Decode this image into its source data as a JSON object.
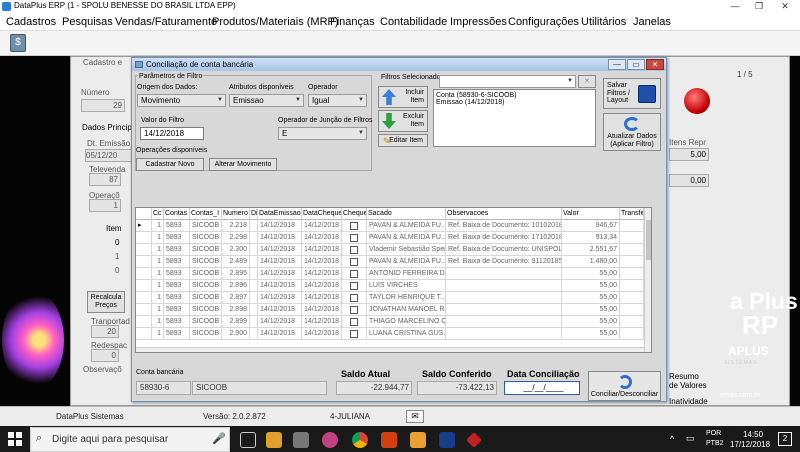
{
  "app": {
    "title": "DataPlus ERP (1 - SPOLU BENESSE DO BRASIL LTDA EPP)",
    "window_controls": {
      "minimize": "—",
      "maximize": "❐",
      "close": "✕"
    },
    "menu": [
      "Cadastros",
      "Pesquisas",
      "Vendas/Faturamento",
      "Produtos/Materiais (MRP)",
      "Finanças",
      "Contabilidade",
      "Impressões",
      "Configurações",
      "Utilitários",
      "Janelas"
    ]
  },
  "background_window": {
    "title": "Cadastro e",
    "numero_label": "Número",
    "numero_value": "29",
    "tab_label": "Dados Princip",
    "dt_emissao_label": "Dt. Emissão",
    "dt_emissao_value": "05/12/20",
    "televendas_label": "Televenda",
    "televendas_value": "87",
    "operacao_label": "Operaçõ",
    "operacao_value": "1",
    "item_label": "Item",
    "item_values": [
      "0",
      "1",
      "0"
    ],
    "recalcular_label": "Recalcula Preços",
    "transportadora_label": "Tranportad",
    "transportadora_value": "20",
    "redespacho_label": "Redespac",
    "redespacho_value": "0",
    "observacoes_label": "Observaçõ",
    "page_counter": "1 / 5",
    "itens_header": "Itens Repr",
    "val_500": "5,00",
    "val_000": "0,00",
    "resumo_label": "Resumo de Valores",
    "inatividade_label": "Inatividade",
    "site_text": "emas.com.br"
  },
  "branding": {
    "line1": "a Plus",
    "line2": "RP",
    "line3": "APLUS",
    "line4": "SISTEMAS"
  },
  "statusbar": {
    "company": "DataPlus Sistemas",
    "version": "Versão: 2.0.2.872",
    "user": "4-JULIANA"
  },
  "dialog": {
    "title": "Conciliação de conta bancária",
    "window_controls": {
      "minimize": "—",
      "maximize": "▭",
      "close": "✕"
    },
    "params_group": "Parâmetros de Filtro",
    "origem_label": "Origem dos Dados:",
    "origem_value": "Movimento",
    "atributos_label": "Atributos disponíveis",
    "atributos_value": "Emissao",
    "operador_label": "Operador",
    "operador_value": "Igual",
    "valor_filtro_label": "Valor do Filtro",
    "valor_filtro_value": "14/12/2018",
    "juncao_label": "Operador de Junção de Filtros",
    "juncao_value": "E",
    "operacoes_label": "Operações disponíveis",
    "cadastrar_novo": "Cadastrar Novo",
    "alterar_movimento": "Alterar Movimento",
    "filtros_selecionados_label": "Filtros Selecionados",
    "filtros_selecionados_items": [
      "Conta (58930-6-SICOOB)",
      "Emissao (14/12/2018)"
    ],
    "incluir_item": "Incluir Item",
    "excluir_item": "Excluir Item",
    "editar_item": "Editar Item",
    "salvar_filtros": "Salvar Filtros / Layout",
    "atualizar_dados": "Atualizar Dados (Aplicar Filtro)",
    "conta_bancaria_label": "Conta bancária",
    "conta_numero": "58930-6",
    "conta_nome": "SICOOB",
    "saldo_atual_label": "Saldo Atual",
    "saldo_atual_value": "-22.944,77",
    "saldo_conferido_label": "Saldo Conferido",
    "saldo_conferido_value": "-73.422,13",
    "data_conciliacao_label": "Data Conciliação",
    "data_conciliacao_value": "__/__/____",
    "conciliar_button": "Conciliar/Desconciliar"
  },
  "grid": {
    "columns": [
      "Cc",
      "Contas",
      "Contas_I",
      "Numero",
      "Di",
      "DataEmissao",
      "DataCheque",
      "Cheque",
      "Sacado",
      "Observacoes",
      "Valor",
      "Transfe"
    ],
    "rows": [
      [
        "1",
        "5893",
        "SICOOB",
        "2.218",
        "14/12/2018",
        "14/12/2018",
        "PAVAN & ALMEIDA FU...",
        "Ref. Baixa de Documento: 10102018...",
        "946,67"
      ],
      [
        "1",
        "5893",
        "SICOOB",
        "2.298",
        "14/12/2018",
        "14/12/2018",
        "PAVAN & ALMEIDA FU...",
        "Ref. Baixa de Documento: 17102018...",
        "913,34"
      ],
      [
        "1",
        "5893",
        "SICOOB",
        "2.300",
        "14/12/2018",
        "14/12/2018",
        "Vlademir Sebastião Sper...",
        "Ref. Baixa de Documento: UNISPOL...",
        "2.551,67"
      ],
      [
        "1",
        "5893",
        "SICOOB",
        "2.489",
        "14/12/2018",
        "14/12/2018",
        "PAVAN & ALMEIDA FU...",
        "Ref. Baixa de Documento: 91120185...",
        "1.480,00"
      ],
      [
        "1",
        "5893",
        "SICOOB",
        "2.895",
        "14/12/2018",
        "14/12/2018",
        "ANTONIO FERREIRA D...",
        "",
        "55,00"
      ],
      [
        "1",
        "5893",
        "SICOOB",
        "2.896",
        "14/12/2018",
        "14/12/2018",
        "LUIS VIRCHES",
        "",
        "55,00"
      ],
      [
        "1",
        "5893",
        "SICOOB",
        "2.897",
        "14/12/2018",
        "14/12/2018",
        "TAYLOR HENRIQUE T...",
        "",
        "55,00"
      ],
      [
        "1",
        "5893",
        "SICOOB",
        "2.898",
        "14/12/2018",
        "14/12/2018",
        "JONATHAN MANOEL R...",
        "",
        "55,00"
      ],
      [
        "1",
        "5893",
        "SICOOB",
        "2.899",
        "14/12/2018",
        "14/12/2018",
        "THIAGO MARCELINO C...",
        "",
        "55,00"
      ],
      [
        "1",
        "5893",
        "SICOOB",
        "2.900",
        "14/12/2018",
        "14/12/2018",
        "LUANA CRISTINA GUS...",
        "",
        "55,00"
      ]
    ]
  },
  "taskbar": {
    "search_placeholder": "Digite aqui para pesquisar",
    "lang": "POR",
    "lang_sub": "PTB2",
    "time": "14:50",
    "date": "17/12/2018",
    "notification_count": "2"
  }
}
